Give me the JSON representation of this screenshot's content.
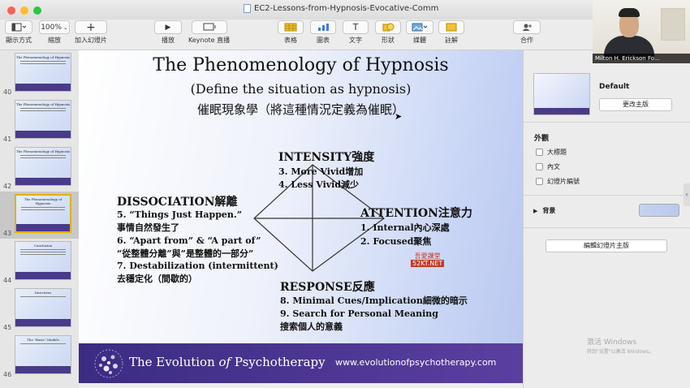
{
  "window": {
    "title": "EC2-Lessons-from-Hypnosis-Evocative-Comm"
  },
  "toolbar": {
    "view_label": "顯示方式",
    "zoom_value": "100%",
    "zoom_label": "縮放",
    "add_slide_label": "加入幻燈片",
    "play_label": "播放",
    "keynote_live_label": "Keynote 直播",
    "table_label": "表格",
    "chart_label": "圖表",
    "text_label": "文字",
    "shape_label": "形狀",
    "media_label": "媒體",
    "comment_label": "註解",
    "collaborate_label": "合作"
  },
  "navigator": {
    "slides": [
      {
        "number": "40",
        "title": "The Phenomenology of Hypnosis"
      },
      {
        "number": "41",
        "title": "The Phenomenology of Hypnosis"
      },
      {
        "number": "42",
        "title": "The Phenomenology of Hypnosis"
      },
      {
        "number": "43",
        "title": "The Phenomenology of Hypnosis",
        "selected": true
      },
      {
        "number": "44",
        "title": "Conclusion"
      },
      {
        "number": "45",
        "title": "Directives"
      },
      {
        "number": "46",
        "title": "The \"Basic\" Models"
      }
    ]
  },
  "slide": {
    "title": "The Phenomenology of Hypnosis",
    "subtitle": "(Define the situation as hypnosis)",
    "subtitle_cn": "催眠現象學（將這種情況定義為催眠）",
    "intensity_heading": "INTENSITY強度",
    "intensity_items": [
      "3. More Vivid增加",
      "4. Less Vivid減少"
    ],
    "dissociation_heading": "DISSOCIATION解離",
    "dissociation_items": [
      "5. “Things Just Happen.”",
      "事情自然發生了",
      "6. “Apart from” & “A part of”",
      "“從整體分離”與”是整體的一部分”",
      "7. Destabilization (intermittent)",
      "去穩定化（間歇的）"
    ],
    "attention_heading": "ATTENTION注意力",
    "attention_items": [
      "1.    Internal內心深處",
      "2.    Focused聚焦"
    ],
    "response_heading": "RESPONSE反應",
    "response_items": [
      "8. Minimal Cues/Implication細微的暗示",
      "9. Search for Personal Meaning",
      "搜索個人的意義"
    ],
    "watermark_top": "吾愛課堂",
    "watermark_bottom": "52KT.NET",
    "footer_brand_pre": "The Evolution ",
    "footer_brand_of": "of",
    "footer_brand_post": " Psychotherapy",
    "footer_url": "www.evolutionofpsychotherapy.com"
  },
  "inspector": {
    "master_name": "Default",
    "change_master_label": "更改主版",
    "appearance_label": "外觀",
    "title_label": "大標題",
    "body_label": "內文",
    "slide_number_label": "幻燈片編號",
    "background_label": "背景",
    "edit_master_label": "編輯幻燈片主版",
    "activate_line1": "激活 Windows",
    "activate_line2": "转到\"设置\"以激活 Windows。"
  },
  "webcam": {
    "name": "Milton H. Erickson Fo..."
  },
  "colors": {
    "footer_band": "#3b2c82",
    "watermark": "#c0392b",
    "selected_border": "#e4b100"
  }
}
